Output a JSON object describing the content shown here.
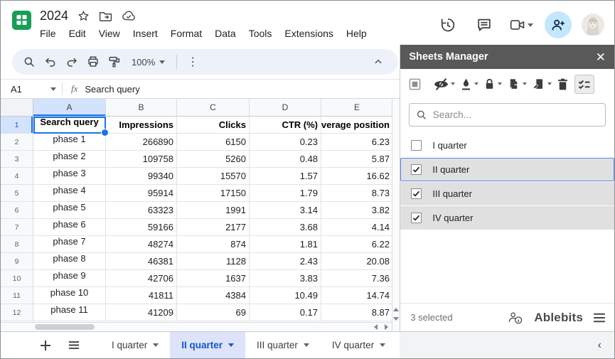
{
  "window": {
    "title": "2024"
  },
  "header": {
    "menu": [
      "File",
      "Edit",
      "View",
      "Insert",
      "Format",
      "Data",
      "Tools",
      "Extensions",
      "Help"
    ]
  },
  "toolbar": {
    "zoom_level": "100%"
  },
  "formula_bar": {
    "cell_ref": "A1",
    "content": "Search query"
  },
  "grid": {
    "col_letters": [
      "A",
      "B",
      "C",
      "D",
      "E"
    ],
    "header_row": [
      "Search query",
      "Impressions",
      "Clicks",
      "CTR (%)",
      "Average position"
    ],
    "rows": [
      [
        "phase 1",
        "266890",
        "6150",
        "0.23",
        "6.23"
      ],
      [
        "phase 2",
        "109758",
        "5260",
        "0.48",
        "5.87"
      ],
      [
        "phase 3",
        "99340",
        "15570",
        "1.57",
        "16.62"
      ],
      [
        "phase 4",
        "95914",
        "17150",
        "1.79",
        "8.73"
      ],
      [
        "phase 5",
        "63323",
        "1991",
        "3.14",
        "3.82"
      ],
      [
        "phase 6",
        "59166",
        "2177",
        "3.68",
        "4.14"
      ],
      [
        "phase 7",
        "48274",
        "874",
        "1.81",
        "6.22"
      ],
      [
        "phase 8",
        "46381",
        "1128",
        "2.43",
        "20.08"
      ],
      [
        "phase 9",
        "42706",
        "1637",
        "3.83",
        "7.36"
      ],
      [
        "phase 10",
        "41811",
        "4384",
        "10.49",
        "14.74"
      ],
      [
        "phase 11",
        "41209",
        "69",
        "0.17",
        "8.87"
      ]
    ]
  },
  "panel": {
    "title": "Sheets Manager",
    "search_placeholder": "Search...",
    "sheets": [
      {
        "label": "I quarter",
        "checked": false,
        "selected": false
      },
      {
        "label": "II quarter",
        "checked": true,
        "selected": true
      },
      {
        "label": "III quarter",
        "checked": true,
        "selected": false
      },
      {
        "label": "IV quarter",
        "checked": true,
        "selected": false
      }
    ],
    "footer": {
      "status": "3 selected",
      "brand": "Ablebits"
    }
  },
  "tabbar": {
    "tabs": [
      {
        "label": "I quarter",
        "active": false
      },
      {
        "label": "II quarter",
        "active": true
      },
      {
        "label": "III quarter",
        "active": false
      },
      {
        "label": "IV quarter",
        "active": false
      }
    ]
  },
  "colors": {
    "sheets_green": "#169f55",
    "accent_blue": "#1a73e8",
    "selected_header_bg": "#d3e3fd",
    "toolbar_pill_bg": "#edf2fa",
    "panel_header_bg": "#595959",
    "panel_row_gray": "#e0e0e0",
    "panel_selected_border": "#5b87e5",
    "tab_active_bg": "#dde3f8",
    "tab_active_text": "#1656cc",
    "share_button_bg": "#c2e7ff"
  }
}
